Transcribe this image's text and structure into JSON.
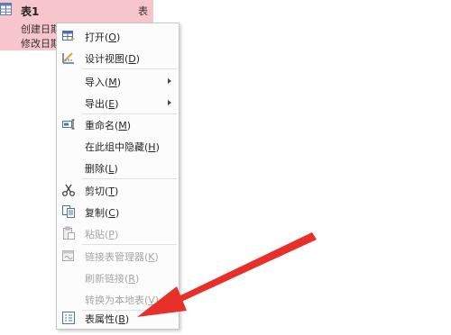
{
  "nav_item": {
    "title": "表1",
    "type": "表",
    "created": "创建日期",
    "modified": "修改日期",
    "highlight": "#f6c6cc"
  },
  "menu": {
    "items": [
      {
        "label": "打开(",
        "key": "O",
        "close": ")",
        "icon": "open-table-icon",
        "disabled": false
      },
      {
        "label": "设计视图(",
        "key": "D",
        "close": ")",
        "icon": "design-view-icon",
        "disabled": false
      },
      {
        "label": "导入(",
        "key": "M",
        "close": ")",
        "icon": "",
        "disabled": false,
        "submenu": true
      },
      {
        "label": "导出(",
        "key": "E",
        "close": ")",
        "icon": "",
        "disabled": false,
        "submenu": true
      },
      {
        "label": "重命名(",
        "key": "M",
        "close": ")",
        "icon": "rename-icon",
        "disabled": false
      },
      {
        "label": "在此组中隐藏(",
        "key": "H",
        "close": ")",
        "icon": "",
        "disabled": false
      },
      {
        "label": "删除(",
        "key": "L",
        "close": ")",
        "icon": "",
        "disabled": false
      },
      {
        "label": "剪切(",
        "key": "T",
        "close": ")",
        "icon": "scissors-icon",
        "disabled": false
      },
      {
        "label": "复制(",
        "key": "C",
        "close": ")",
        "icon": "copy-icon",
        "disabled": false
      },
      {
        "label": "粘贴(",
        "key": "P",
        "close": ")",
        "icon": "paste-icon",
        "disabled": true
      },
      {
        "label": "链接表管理器(",
        "key": "K",
        "close": ")",
        "icon": "linked-table-manager-icon",
        "disabled": true
      },
      {
        "label": "刷新链接(",
        "key": "R",
        "close": ")",
        "icon": "",
        "disabled": true
      },
      {
        "label": "转换为本地表(",
        "key": "V",
        "close": ")",
        "icon": "",
        "disabled": true
      },
      {
        "label": "表属性(",
        "key": "B",
        "close": ")",
        "icon": "table-properties-icon",
        "disabled": false
      }
    ]
  },
  "annotation": {
    "color": "#e8302a"
  }
}
